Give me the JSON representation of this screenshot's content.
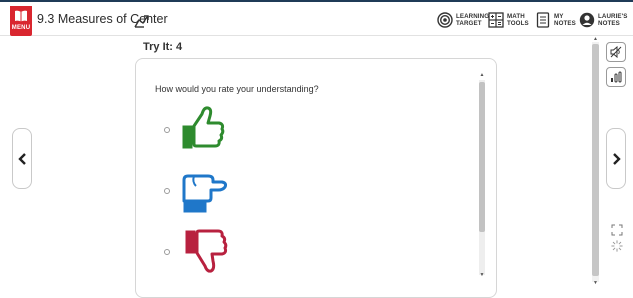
{
  "header": {
    "menu_label": "MENU",
    "title": "9.3 Measures of Center",
    "tools": [
      {
        "icon": "target-icon",
        "line1": "LEARNING",
        "line2": "TARGET"
      },
      {
        "icon": "math-tools-icon",
        "line1": "MATH",
        "line2": "TOOLS"
      },
      {
        "icon": "notes-icon",
        "line1": "MY",
        "line2": "NOTES"
      },
      {
        "icon": "user-notes-icon",
        "line1": "LAURIE'S",
        "line2": "NOTES"
      }
    ]
  },
  "main": {
    "heading": "Try It: 4",
    "question": "How would you rate your understanding?",
    "options": [
      {
        "icon": "thumbs-up-icon",
        "color": "#2e8b2e"
      },
      {
        "icon": "thumbs-sideways-icon",
        "color": "#1f77c9"
      },
      {
        "icon": "thumbs-down-icon",
        "color": "#b8213f"
      }
    ]
  },
  "nav": {
    "prev_icon": "chevron-left-icon",
    "next_icon": "chevron-right-icon"
  },
  "side_tools": {
    "mute_icon": "speaker-mute-icon",
    "audio_icon": "audio-bars-icon",
    "fullscreen_icon": "fullscreen-icon",
    "spinner_icon": "loading-spinner-icon"
  },
  "colors": {
    "menu_red": "#d9262f",
    "header_line": "#1f3b57"
  }
}
